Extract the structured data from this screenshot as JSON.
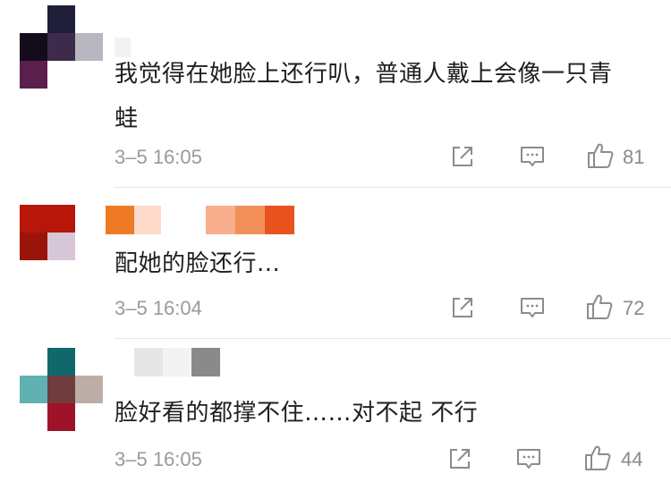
{
  "comments": [
    {
      "text": "我觉得在她脸上还行叭，普通人戴上会像一只青蛙",
      "time": "3–5 16:05",
      "likes": "81",
      "avatar_colors": [
        "#1f1f3a",
        "#140b1c",
        "#3e2a4a",
        "#b9b6bf",
        "#5a1f4d"
      ],
      "name_colors": [
        "#ececec",
        "#d8d8d8",
        "#7a7a7a"
      ]
    },
    {
      "text": "配她的脸还行...",
      "time": "3–5 16:04",
      "likes": "72",
      "avatar_colors": [
        "#b8150b",
        "#b8150b",
        "#9b1409",
        "#d7c6d6",
        "#ffffff"
      ],
      "name_colors": [
        "#ef7a25",
        "#fddac9",
        "#f8ad8c",
        "#f39059",
        "#e9521e"
      ]
    },
    {
      "text": "脸好看的都撑不住……对不起 不行",
      "time": "3–5 16:05",
      "likes": "44",
      "avatar_colors": [
        "#11686b",
        "#60b1b1",
        "#713c3d",
        "#bcaea7",
        "#9e1329"
      ],
      "name_colors": [
        "#e6e6e6",
        "#f3f3f3",
        "#8a8a8a"
      ]
    }
  ],
  "icons": {
    "share": "share-icon",
    "reply": "comment-icon",
    "like": "thumbs-up-icon"
  }
}
